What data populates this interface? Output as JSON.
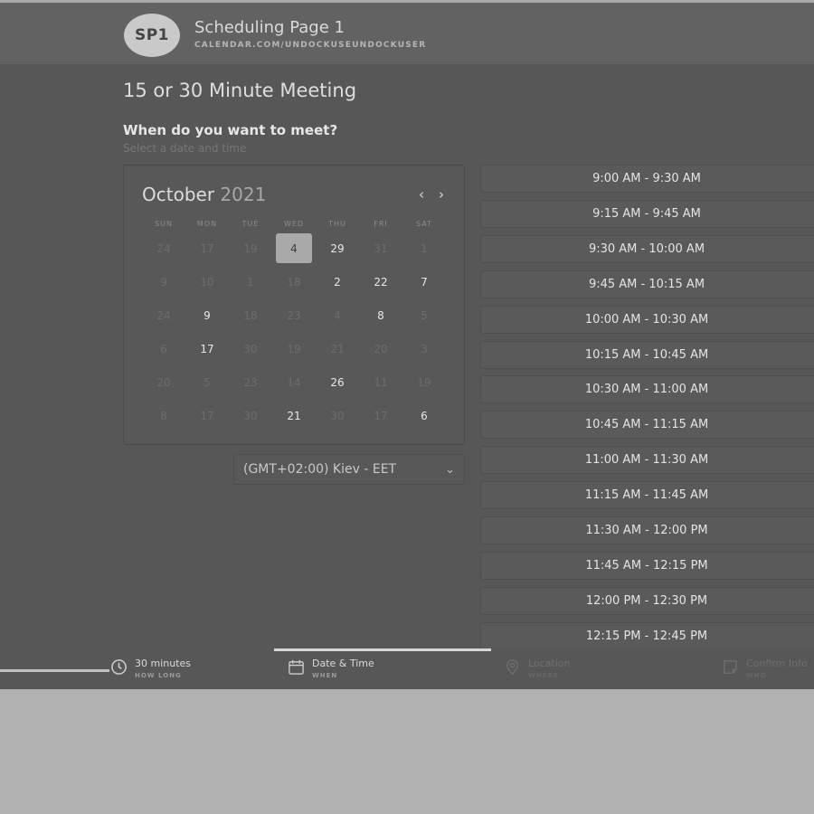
{
  "header": {
    "avatar": "SP1",
    "title": "Scheduling Page 1",
    "url": "CALENDAR.COM/UNDOCKUSEUNDOCKUSER"
  },
  "meeting": {
    "title": "15 or 30 Minute Meeting",
    "question": "When do you want to meet?",
    "hint": "Select a date and time"
  },
  "calendar": {
    "month": "October",
    "year": "2021",
    "prev_icon": "chevron-left-icon",
    "next_icon": "chevron-right-icon",
    "weekdays": [
      "SUN",
      "MON",
      "TUE",
      "WED",
      "THU",
      "FRI",
      "SAT"
    ],
    "weeks": [
      [
        {
          "d": "24",
          "a": false
        },
        {
          "d": "17",
          "a": false
        },
        {
          "d": "19",
          "a": false
        },
        {
          "d": "4",
          "a": true,
          "s": true
        },
        {
          "d": "29",
          "a": true
        },
        {
          "d": "31",
          "a": false
        },
        {
          "d": "1",
          "a": false
        }
      ],
      [
        {
          "d": "9",
          "a": false
        },
        {
          "d": "10",
          "a": false
        },
        {
          "d": "1",
          "a": false
        },
        {
          "d": "18",
          "a": false
        },
        {
          "d": "2",
          "a": true
        },
        {
          "d": "22",
          "a": true
        },
        {
          "d": "7",
          "a": true
        }
      ],
      [
        {
          "d": "24",
          "a": false
        },
        {
          "d": "9",
          "a": true
        },
        {
          "d": "18",
          "a": false
        },
        {
          "d": "23",
          "a": false
        },
        {
          "d": "4",
          "a": false
        },
        {
          "d": "8",
          "a": true
        },
        {
          "d": "5",
          "a": false
        }
      ],
      [
        {
          "d": "6",
          "a": false
        },
        {
          "d": "17",
          "a": true
        },
        {
          "d": "30",
          "a": false
        },
        {
          "d": "19",
          "a": false
        },
        {
          "d": "21",
          "a": false
        },
        {
          "d": "20",
          "a": false
        },
        {
          "d": "3",
          "a": false
        }
      ],
      [
        {
          "d": "20",
          "a": false
        },
        {
          "d": "5",
          "a": false
        },
        {
          "d": "23",
          "a": false
        },
        {
          "d": "14",
          "a": false
        },
        {
          "d": "26",
          "a": true
        },
        {
          "d": "11",
          "a": false
        },
        {
          "d": "19",
          "a": false
        }
      ],
      [
        {
          "d": "8",
          "a": false
        },
        {
          "d": "17",
          "a": false
        },
        {
          "d": "30",
          "a": false
        },
        {
          "d": "21",
          "a": true
        },
        {
          "d": "30",
          "a": false
        },
        {
          "d": "17",
          "a": false
        },
        {
          "d": "6",
          "a": true
        }
      ]
    ]
  },
  "timezone": {
    "label": "(GMT+02:00) Kiev - EET",
    "icon": "chevron-down-icon"
  },
  "slots": [
    "9:00 AM - 9:30 AM",
    "9:15 AM - 9:45 AM",
    "9:30 AM - 10:00 AM",
    "9:45 AM - 10:15 AM",
    "10:00 AM - 10:30 AM",
    "10:15 AM - 10:45 AM",
    "10:30 AM - 11:00 AM",
    "10:45 AM - 11:15 AM",
    "11:00 AM - 11:30 AM",
    "11:15 AM - 11:45 AM",
    "11:30 AM - 12:00 PM",
    "11:45 AM - 12:15 PM",
    "12:00 PM - 12:30 PM",
    "12:15 PM - 12:45 PM"
  ],
  "steps": [
    {
      "label": "30 minutes",
      "sub": "HOW LONG",
      "icon": "clock-icon"
    },
    {
      "label": "Date & Time",
      "sub": "WHEN",
      "icon": "calendar-icon"
    },
    {
      "label": "Location",
      "sub": "WHERE",
      "icon": "location-pin-icon"
    },
    {
      "label": "Confirm Info",
      "sub": "WHO",
      "icon": "note-icon"
    }
  ]
}
